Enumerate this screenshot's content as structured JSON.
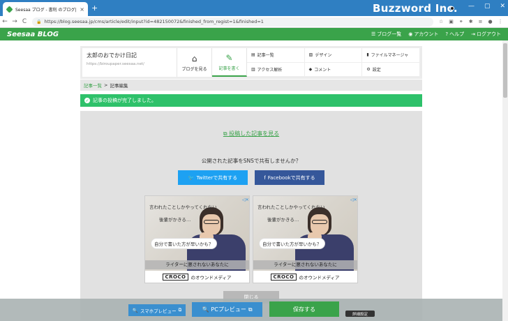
{
  "browser": {
    "tab_title": "Seesaa ブログ - 書利 のブログ|blog/",
    "tab_close": "×",
    "new_tab": "+",
    "url": "https://blog.seesaa.jp/cms/article/edit/input?id=482150072&finished_from_regist=1&finished=1",
    "brand_overlay": "Buzzword Inc.",
    "nav": {
      "back": "←",
      "forward": "→",
      "reload": "C"
    }
  },
  "header": {
    "logo": "Seesaa BLOG",
    "links": [
      {
        "icon": "☰",
        "label": "ブログ一覧"
      },
      {
        "icon": "◉",
        "label": "アカウント"
      },
      {
        "icon": "?",
        "label": "ヘルプ"
      },
      {
        "icon": "⇥",
        "label": "ログアウト"
      }
    ]
  },
  "blog": {
    "name": "太郎のおでかけ日記",
    "url": "https://biroupaper.seesaa.net/",
    "view_label": "ブログを見る",
    "write_label": "記事を書く",
    "menu": [
      {
        "icon": "▤",
        "label": "記事一覧"
      },
      {
        "icon": "▧",
        "label": "デザイン"
      },
      {
        "icon": "▮",
        "label": "ファイルマネージャ"
      },
      {
        "icon": "▥",
        "label": "アクセス解析"
      },
      {
        "icon": "◆",
        "label": "コメント"
      },
      {
        "icon": "⚙",
        "label": "設定"
      }
    ]
  },
  "breadcrumb": {
    "link": "記事一覧",
    "sep": ">",
    "current": "記事編集"
  },
  "alert": {
    "message": "記事の投稿が完了しました。"
  },
  "content": {
    "view_post": "投稿した記事を見る",
    "share_question": "公開された記事をSNSで共有しませんか？",
    "twitter_label": "Twitterで共有する",
    "facebook_label": "Facebookで共有する",
    "close_label": "閉じる"
  },
  "ad": {
    "line1": "言われたことしかやってくれない",
    "line2": "後輩がかきる…",
    "bubble": "自分で書いた方が早いかも？",
    "strip": "ライターに悪されないあなたに",
    "logo": "CROCO",
    "tagline": "のオウンドメディア"
  },
  "bottom": {
    "sp_preview": "スマホプレビュー",
    "pc_preview": "PCプレビュー",
    "save": "保存する",
    "detail": "詳細設定"
  }
}
